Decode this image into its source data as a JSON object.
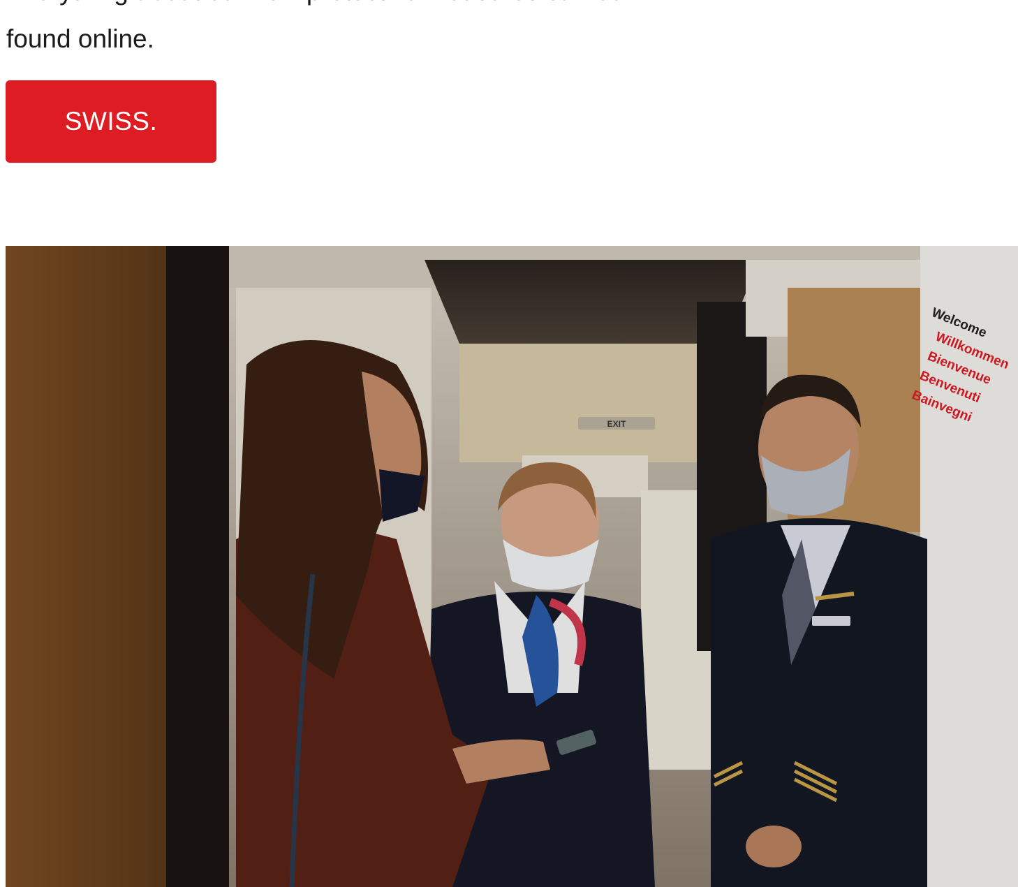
{
  "intro": {
    "line1": "Everything about our new protective measures can be",
    "line2": "found online."
  },
  "cta": {
    "label": "SWISS.",
    "color": "#dd1c24"
  },
  "photo": {
    "exit_sign": "EXIT",
    "welcome_sign": [
      "Welcome",
      "Willkommen",
      "Bienvenue",
      "Benvenuti",
      "Bainvegni"
    ]
  }
}
